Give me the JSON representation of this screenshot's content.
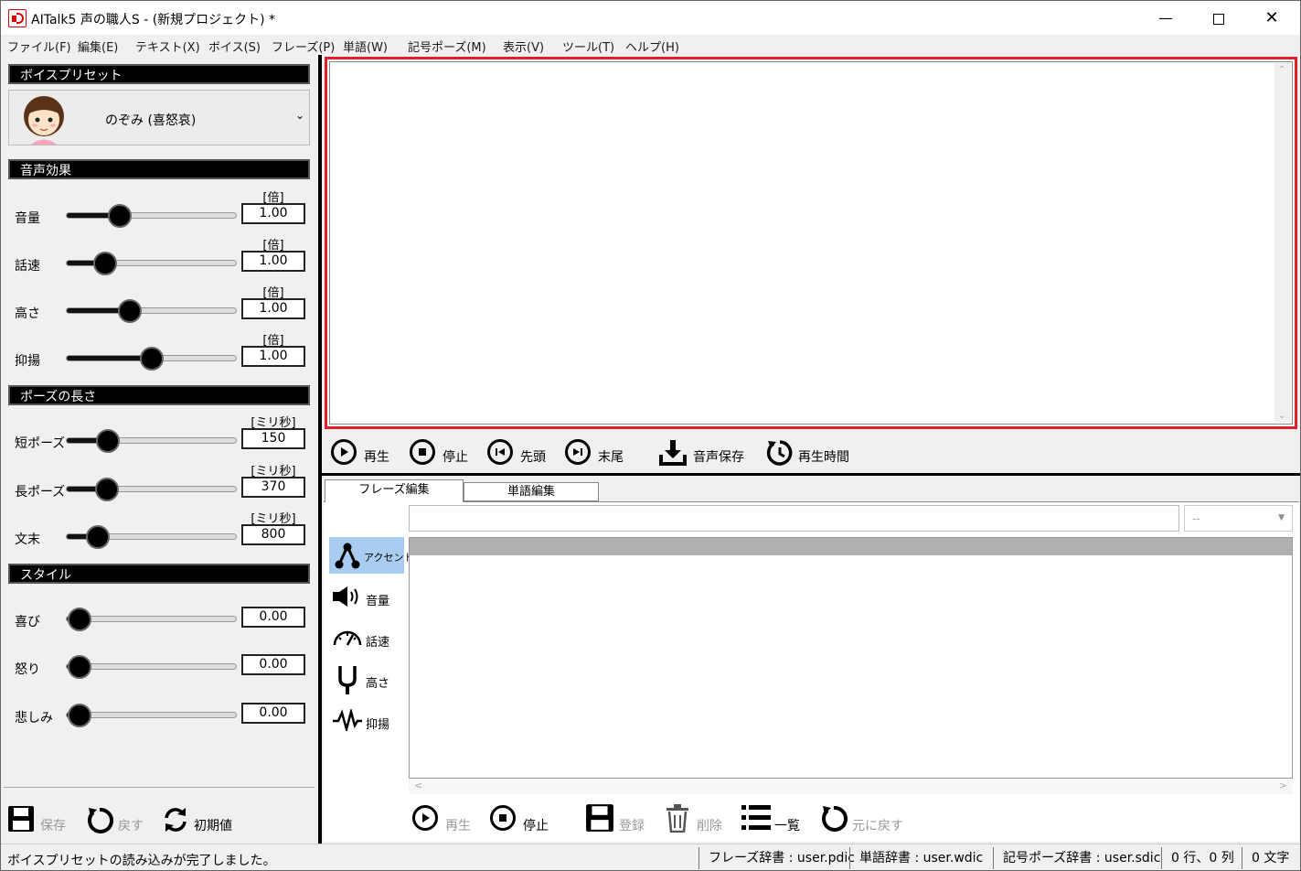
{
  "window": {
    "title": "AITalk5 声の職人S - (新規プロジェクト) *",
    "minimize": "—",
    "close": "✕"
  },
  "menu": [
    "ファイル(F)",
    "編集(E)",
    "テキスト(X)",
    "ボイス(S)",
    "フレーズ(P)",
    "単語(W)",
    "記号ポーズ(M)",
    "表示(V)",
    "ツール(T)",
    "ヘルプ(H)"
  ],
  "left": {
    "preset_header": "ボイスプリセット",
    "preset_name": "のぞみ (喜怒哀)",
    "effects_header": "音声効果",
    "effects": [
      {
        "label": "音量",
        "unit": "[倍]",
        "value": "1.00",
        "level": 0.28
      },
      {
        "label": "話速",
        "unit": "[倍]",
        "value": "1.00",
        "level": 0.18
      },
      {
        "label": "高さ",
        "unit": "[倍]",
        "value": "1.00",
        "level": 0.35
      },
      {
        "label": "抑揚",
        "unit": "[倍]",
        "value": "1.00",
        "level": 0.5
      }
    ],
    "pause_header": "ポーズの長さ",
    "pauses": [
      {
        "label": "短ポーズ",
        "unit": "[ミリ秒]",
        "value": "150",
        "level": 0.2
      },
      {
        "label": "長ポーズ",
        "unit": "[ミリ秒]",
        "value": "370",
        "level": 0.19
      },
      {
        "label": "文末",
        "unit": "[ミリ秒]",
        "value": "800",
        "level": 0.13
      }
    ],
    "style_header": "スタイル",
    "styles": [
      {
        "label": "喜び",
        "value": "0.00",
        "level": 0.0
      },
      {
        "label": "怒り",
        "value": "0.00",
        "level": 0.0
      },
      {
        "label": "悲しみ",
        "value": "0.00",
        "level": 0.0
      }
    ],
    "save": "保存",
    "undo": "戻す",
    "reset": "初期値"
  },
  "playback": {
    "play": "再生",
    "stop": "停止",
    "head": "先頭",
    "tail": "末尾",
    "save_audio": "音声保存",
    "play_time": "再生時間"
  },
  "tabs": {
    "phrase": "フレーズ編集",
    "word": "単語編集"
  },
  "phrase_select": "--",
  "side_tabs": [
    "アクセント",
    "音量",
    "話速",
    "高さ",
    "抑揚"
  ],
  "edit_buttons": {
    "play": "再生",
    "stop": "停止",
    "register": "登録",
    "delete": "削除",
    "list": "一覧",
    "revert": "元に戻す"
  },
  "status": {
    "message": "ボイスプリセットの読み込みが完了しました。",
    "phrase_dict": "フレーズ辞書 : user.pdic",
    "word_dict": "単語辞書 : user.wdic",
    "symbol_dict": "記号ポーズ辞書 : user.sdic",
    "cursor": "0 行、0 列",
    "chars": "0 文字"
  }
}
